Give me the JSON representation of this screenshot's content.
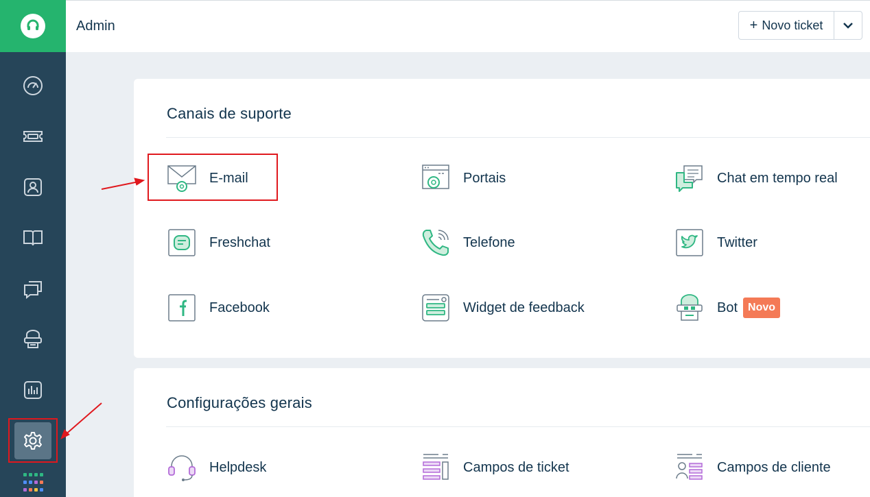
{
  "header": {
    "title": "Admin",
    "new_ticket_label": "Novo ticket",
    "new_ticket_plus": "+"
  },
  "sidebar": {
    "logo": "headset-icon",
    "items": [
      {
        "name": "dashboard",
        "icon": "speedometer-icon"
      },
      {
        "name": "tickets",
        "icon": "ticket-icon"
      },
      {
        "name": "contacts",
        "icon": "contact-card-icon"
      },
      {
        "name": "solutions",
        "icon": "book-icon"
      },
      {
        "name": "forums",
        "icon": "chat-bubbles-icon"
      },
      {
        "name": "bots",
        "icon": "bot-icon"
      },
      {
        "name": "reports",
        "icon": "bar-chart-icon"
      },
      {
        "name": "admin",
        "icon": "gear-icon",
        "active": true
      }
    ],
    "apps_icon": "apps-grid-icon"
  },
  "support_channels": {
    "title": "Canais de suporte",
    "items": [
      {
        "label": "E-mail",
        "icon": "email-gear-icon"
      },
      {
        "label": "Portais",
        "icon": "portal-icon"
      },
      {
        "label": "Chat em tempo real",
        "icon": "chat-icon"
      },
      {
        "label": "Freshchat",
        "icon": "freshchat-icon"
      },
      {
        "label": "Telefone",
        "icon": "phone-icon"
      },
      {
        "label": "Twitter",
        "icon": "twitter-icon"
      },
      {
        "label": "Facebook",
        "icon": "facebook-icon"
      },
      {
        "label": "Widget de feedback",
        "icon": "feedback-widget-icon"
      },
      {
        "label": "Bot",
        "icon": "bot-icon",
        "badge": "Novo"
      }
    ]
  },
  "general_settings": {
    "title": "Configurações gerais",
    "items": [
      {
        "label": "Helpdesk",
        "icon": "headset-icon"
      },
      {
        "label": "Campos de ticket",
        "icon": "ticket-fields-icon"
      },
      {
        "label": "Campos de cliente",
        "icon": "customer-fields-icon"
      }
    ]
  },
  "colors": {
    "sidebar": "#264559",
    "brand_green": "#25b46e",
    "accent_green": "#2fb783",
    "purple": "#b36bd8",
    "badge": "#f47a56",
    "annotation_red": "#e0181d"
  }
}
